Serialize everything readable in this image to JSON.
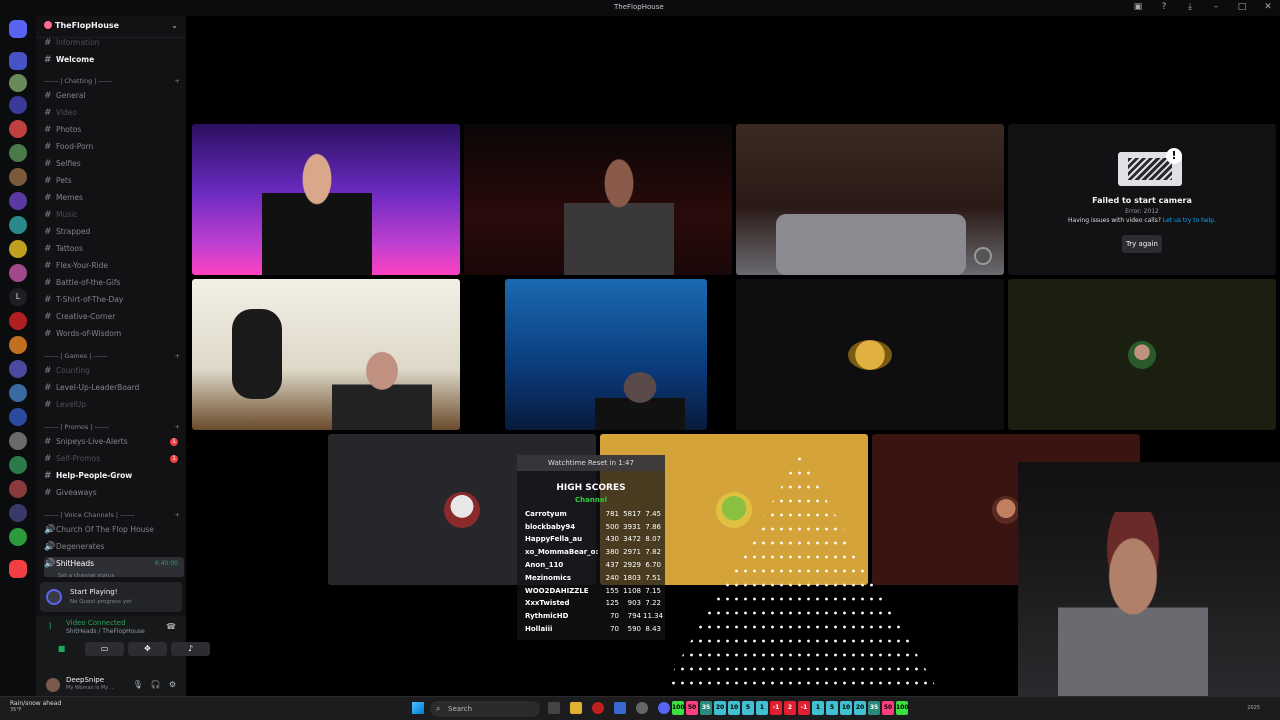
{
  "window": {
    "title": "TheFlopHouse"
  },
  "colors": {
    "accent": "#5865f2",
    "online": "#23a559",
    "mention": "#f23f43",
    "link": "#00a8fc"
  },
  "server": {
    "name": "TheFlopHouse"
  },
  "channels": {
    "information": "Information",
    "welcome": "Welcome",
    "cat_chatting": "------ | Chatting | ------",
    "general": "General",
    "video": "Video",
    "photos": "Photos",
    "food_porn": "Food-Porn",
    "selfies": "Selfies",
    "pets": "Pets",
    "memes": "Memes",
    "music": "Music",
    "strapped": "Strapped",
    "tattoos": "Tattoos",
    "flex_your_ride": "Flex-Your-Ride",
    "battle_of_the_gifs": "Battle-of-the-Gifs",
    "tshirt": "T-Shirt-of-The-Day",
    "creative_corner": "Creative-Corner",
    "words_of_wisdom": "Words-of-Wisdom",
    "cat_games": "------ | Games | ------",
    "counting": "Counting",
    "leaderboard": "Level-Up-LeaderBoard",
    "levelup": "LevelUp",
    "cat_promos": "------ | Promos | ------",
    "snipeys_live_alerts": "Snipeys-Live-Alerts",
    "self_promos": "Self-Promos",
    "help_people_grow": "Help-People-Grow",
    "giveaways": "Giveaways",
    "cat_voice": "------ | Voice Channels | ------",
    "church": "Church Of The Flop House",
    "degenerates": "Degenerates",
    "shitheads": "ShitHeads",
    "shitheads_status": "Set a channel status",
    "shitheads_timer": "6:40:00",
    "badge_alerts": "1",
    "badge_promos": "1"
  },
  "quest": {
    "title": "Start Playing!",
    "sub": "No Quest progress yet"
  },
  "voice": {
    "status": "Video Connected",
    "location": "ShitHeads / TheFlopHouse"
  },
  "user": {
    "name": "DeepSnipe",
    "status": "My Woman Is My ..."
  },
  "camera_error": {
    "title": "Failed to start camera",
    "code": "Error: 2012",
    "help_text": "Having issues with video calls?",
    "help_link": "Let us try to help.",
    "retry_label": "Try again"
  },
  "overlay": {
    "reset_text": "Watchtime Reset in 1:47",
    "title": "HIGH SCORES",
    "subtitle": "Channel",
    "rows": [
      {
        "name": "Carrotyum",
        "a": "781",
        "b": "5817",
        "c": "7.45"
      },
      {
        "name": "blockbaby94",
        "a": "500",
        "b": "3931",
        "c": "7.86"
      },
      {
        "name": "HappyFella_au",
        "a": "430",
        "b": "3472",
        "c": "8.07"
      },
      {
        "name": "xo_MommaBear_o:",
        "a": "380",
        "b": "2971",
        "c": "7.82"
      },
      {
        "name": "Anon_110",
        "a": "437",
        "b": "2929",
        "c": "6.70"
      },
      {
        "name": "Mezinomics",
        "a": "240",
        "b": "1803",
        "c": "7.51"
      },
      {
        "name": "WOO2DAHIZZLE",
        "a": "155",
        "b": "1108",
        "c": "7.15"
      },
      {
        "name": "XxxTwisted",
        "a": "125",
        "b": "903",
        "c": "7.22"
      },
      {
        "name": "RythmicHD",
        "a": "70",
        "b": "794",
        "c": "11.34"
      },
      {
        "name": "Hollaiii",
        "a": "70",
        "b": "590",
        "c": "8.43"
      }
    ]
  },
  "taskbar": {
    "weather_title": "Rain/snow ahead",
    "weather_temp": "35°F",
    "search_placeholder": "Search",
    "tray_numbers": [
      "100",
      "50",
      "35",
      "20",
      "10",
      "5",
      "1",
      "-1",
      "2",
      "-1",
      "1",
      "5",
      "10",
      "20",
      "35",
      "50",
      "100"
    ],
    "clock": "2025"
  }
}
